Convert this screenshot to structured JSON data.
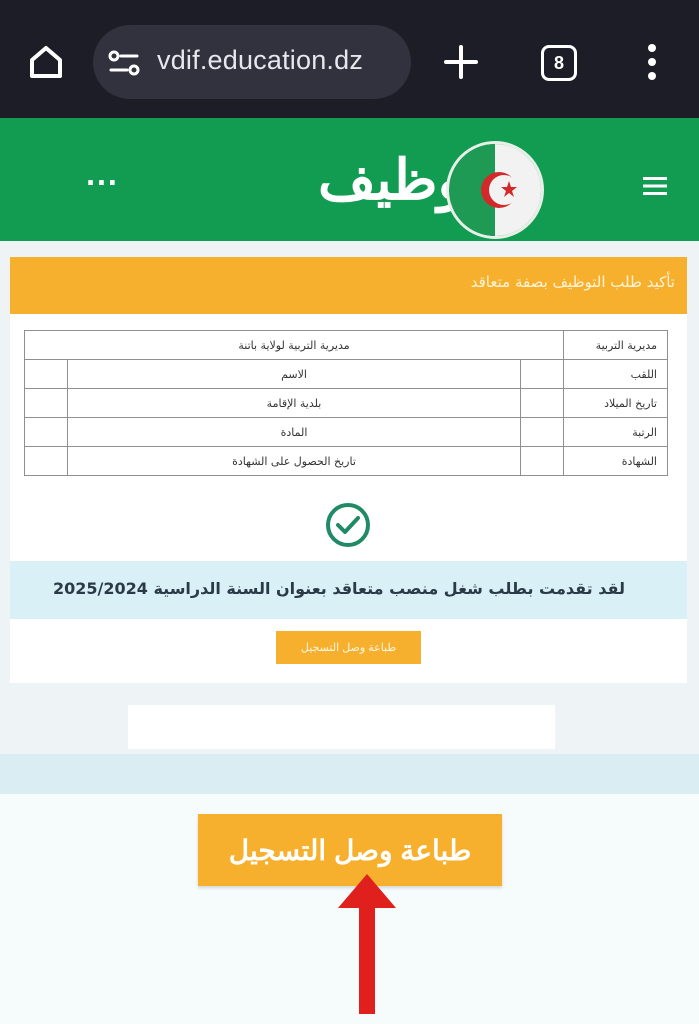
{
  "browser": {
    "url": "vdif.education.dz",
    "tab_count": "8"
  },
  "header": {
    "logo_text": "توظيف",
    "menu_dots": "..."
  },
  "card": {
    "banner_text": "تأكيد طلب التوظيف بصفة متعاقد",
    "table": {
      "rows": [
        {
          "label": "مديرية التربية",
          "value1": "مديرية التربية لولاية باتنة",
          "label2": "",
          "value2": ""
        },
        {
          "label": "اللقب",
          "value1": "",
          "label2": "الاسم",
          "value2": ""
        },
        {
          "label": "تاريخ الميلاد",
          "value1": "",
          "label2": "بلدية الإقامة",
          "value2": ""
        },
        {
          "label": "الرتبة",
          "value1": "",
          "label2": "المادة",
          "value2": ""
        },
        {
          "label": "الشهادة",
          "value1": "",
          "label2": "تاريخ الحصول على الشهادة",
          "value2": ""
        }
      ]
    },
    "notice_text": "لقد تقدمت بطلب شغل منصب متعاقد بعنوان السنة الدراسية 2025/2024",
    "print_button_small": "طباعة وصل التسجيل"
  },
  "print_button_large": "طباعة وصل التسجيل",
  "colors": {
    "header_green": "#119c52",
    "accent_orange": "#f7b02d",
    "check_green": "#1f8a63",
    "arrow_red": "#e0201c"
  }
}
